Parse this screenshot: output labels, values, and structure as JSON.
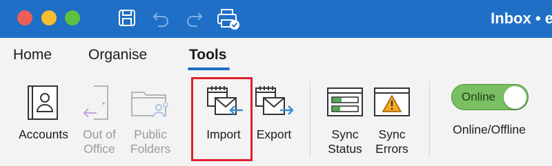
{
  "titlebar": {
    "title": "Inbox • e",
    "icons": [
      "save-icon",
      "undo-icon",
      "redo-icon",
      "print-sync-icon"
    ]
  },
  "tabs": [
    {
      "label": "Home"
    },
    {
      "label": "Organise"
    },
    {
      "label": "Tools",
      "active": true
    }
  ],
  "ribbon": {
    "accounts": {
      "line1": "Accounts",
      "line2": "",
      "enabled": true
    },
    "out_of_office": {
      "line1": "Out of",
      "line2": "Office",
      "enabled": false
    },
    "public_folders": {
      "line1": "Public",
      "line2": "Folders",
      "enabled": false
    },
    "import": {
      "line1": "Import",
      "line2": "",
      "enabled": true,
      "highlighted": true
    },
    "export": {
      "line1": "Export",
      "line2": "",
      "enabled": true
    },
    "sync_status": {
      "line1": "Sync",
      "line2": "Status",
      "enabled": true
    },
    "sync_errors": {
      "line1": "Sync",
      "line2": "Errors",
      "enabled": true
    },
    "online_toggle": {
      "state_text": "Online",
      "label": "Online/Offline",
      "on": true
    }
  },
  "colors": {
    "titlebar": "#1f6fc6",
    "tab_underline": "#1f6fc6",
    "highlight": "#e01e2b",
    "toggle_on": "#7ac062"
  }
}
